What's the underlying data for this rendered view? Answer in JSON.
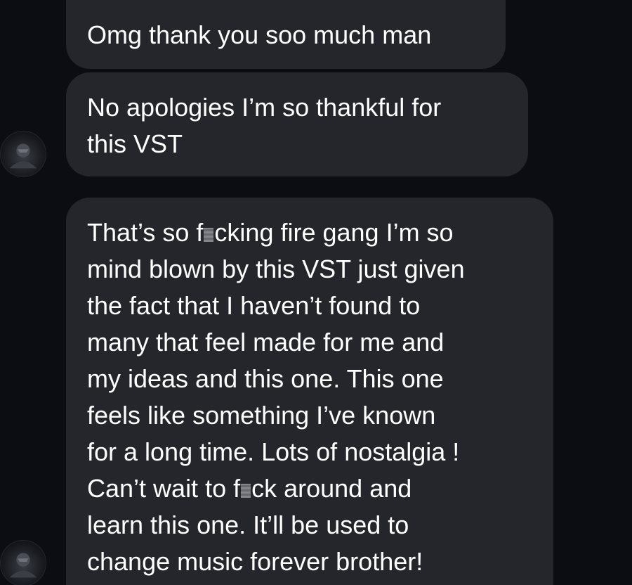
{
  "messages": [
    {
      "lines": [
        "Omg thank you soo much man"
      ]
    },
    {
      "lines": [
        "No apologies I’m so thankful for",
        "this VST"
      ]
    },
    {
      "line1_pre": "That’s so f",
      "line1_post": "cking fire gang I’m so",
      "line2": "mind blown by this VST just given",
      "line3": "the fact that I haven’t found to",
      "line4": "many that feel made for me and",
      "line5": "my ideas and this one. This one",
      "line6": "feels like something I’ve known",
      "line7": "for a long time. Lots of nostalgia !",
      "line8_pre": "Can’t wait to f",
      "line8_post": "ck around and",
      "line9": "learn this one. It’ll be used to",
      "line10": "change music forever brother!"
    }
  ],
  "avatar_icon": "profile-avatar-icon"
}
